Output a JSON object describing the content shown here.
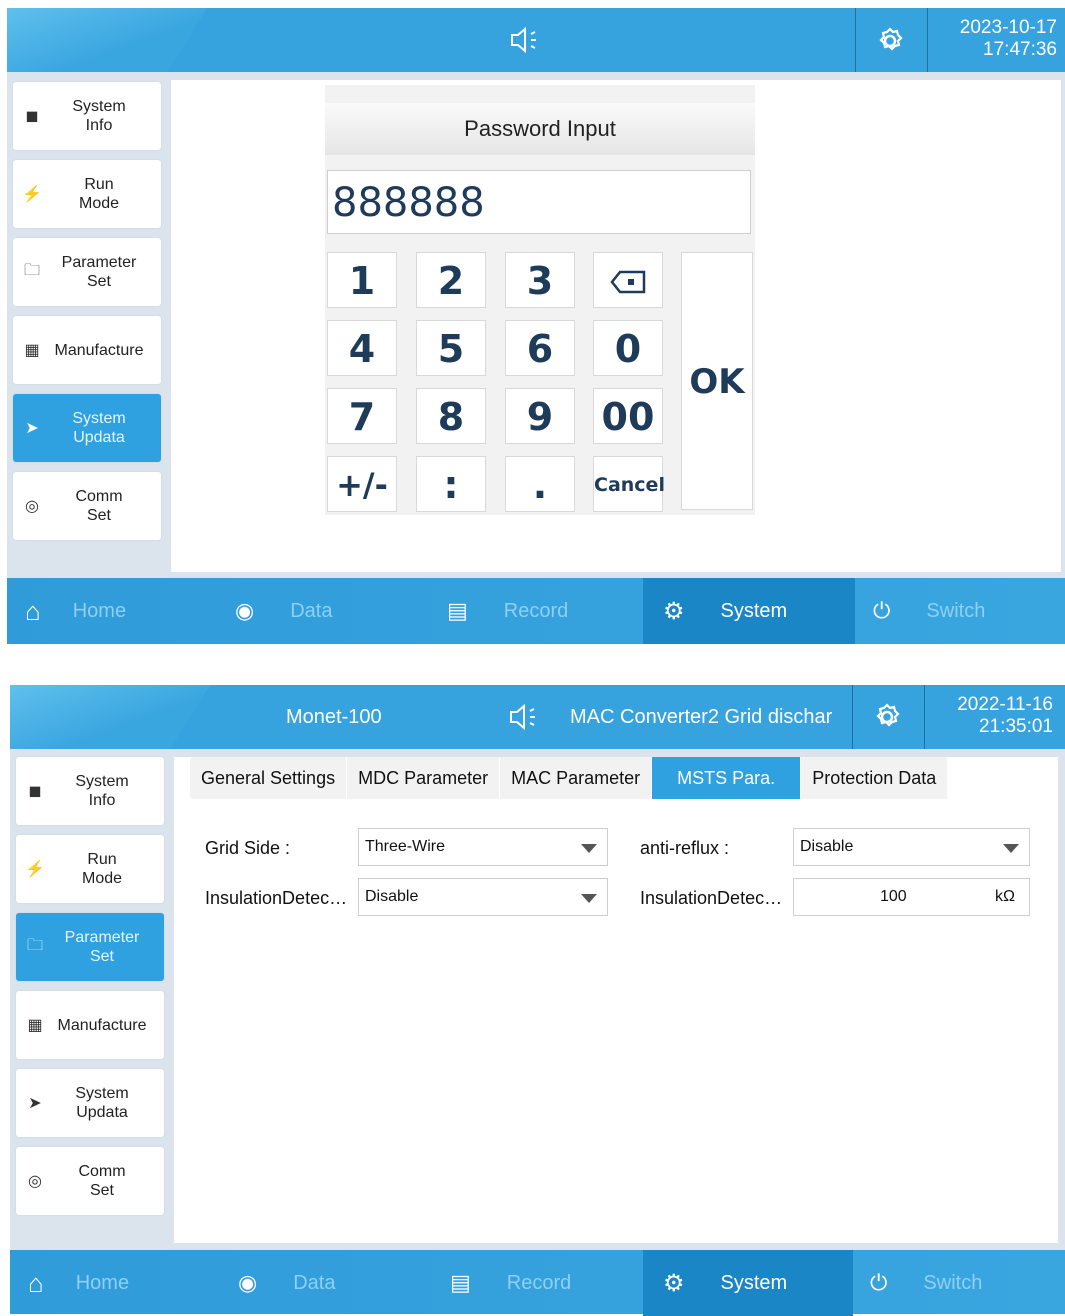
{
  "screen1": {
    "header": {
      "date": "2023-10-17",
      "time": "17:47:36"
    },
    "sidebar": [
      {
        "label": "System\nInfo",
        "icon": "box-icon"
      },
      {
        "label": "Run\nMode",
        "icon": "bolt-icon"
      },
      {
        "label": "Parameter\nSet",
        "icon": "folder-gear-icon"
      },
      {
        "label": "Manufacture",
        "icon": "building-icon"
      },
      {
        "label": "System\nUpdata",
        "icon": "rocket-icon",
        "active": true
      },
      {
        "label": "Comm\nSet",
        "icon": "signal-icon"
      }
    ],
    "dialog": {
      "title": "Password Input",
      "value": "888888",
      "keys": [
        "1",
        "2",
        "3",
        "4",
        "5",
        "6",
        "0",
        "7",
        "8",
        "9",
        "00",
        "+/-",
        ":",
        ".",
        "Cancel"
      ],
      "ok": "OK"
    },
    "nav": [
      {
        "label": "Home"
      },
      {
        "label": "Data"
      },
      {
        "label": "Record"
      },
      {
        "label": "System",
        "active": true
      },
      {
        "label": "Switch"
      }
    ]
  },
  "screen2": {
    "header": {
      "device": "Monet-100",
      "status": "MAC Converter2 Grid dischar",
      "date": "2022-11-16",
      "time": "21:35:01"
    },
    "sidebar": [
      {
        "label": "System\nInfo"
      },
      {
        "label": "Run\nMode"
      },
      {
        "label": "Parameter\nSet",
        "active": true
      },
      {
        "label": "Manufacture"
      },
      {
        "label": "System\nUpdata"
      },
      {
        "label": "Comm\nSet"
      }
    ],
    "tabs": [
      "General Settings",
      "MDC Parameter",
      "MAC Parameter",
      "MSTS Para.",
      "Protection Data"
    ],
    "fields": {
      "grid_side_label": "Grid Side :",
      "grid_side_value": "Three-Wire",
      "anti_reflux_label": "anti-reflux :",
      "anti_reflux_value": "Disable",
      "insulation1_label": "InsulationDetec…",
      "insulation1_value": "Disable",
      "insulation2_label": "InsulationDetec…",
      "insulation2_value": "100",
      "insulation2_unit": "kΩ"
    },
    "nav": [
      {
        "label": "Home"
      },
      {
        "label": "Data"
      },
      {
        "label": "Record"
      },
      {
        "label": "System",
        "active": true
      },
      {
        "label": "Switch"
      }
    ]
  },
  "colors": {
    "accent": "#36a3df",
    "active": "#2fa0e0",
    "panel": "#dbe4ec"
  }
}
